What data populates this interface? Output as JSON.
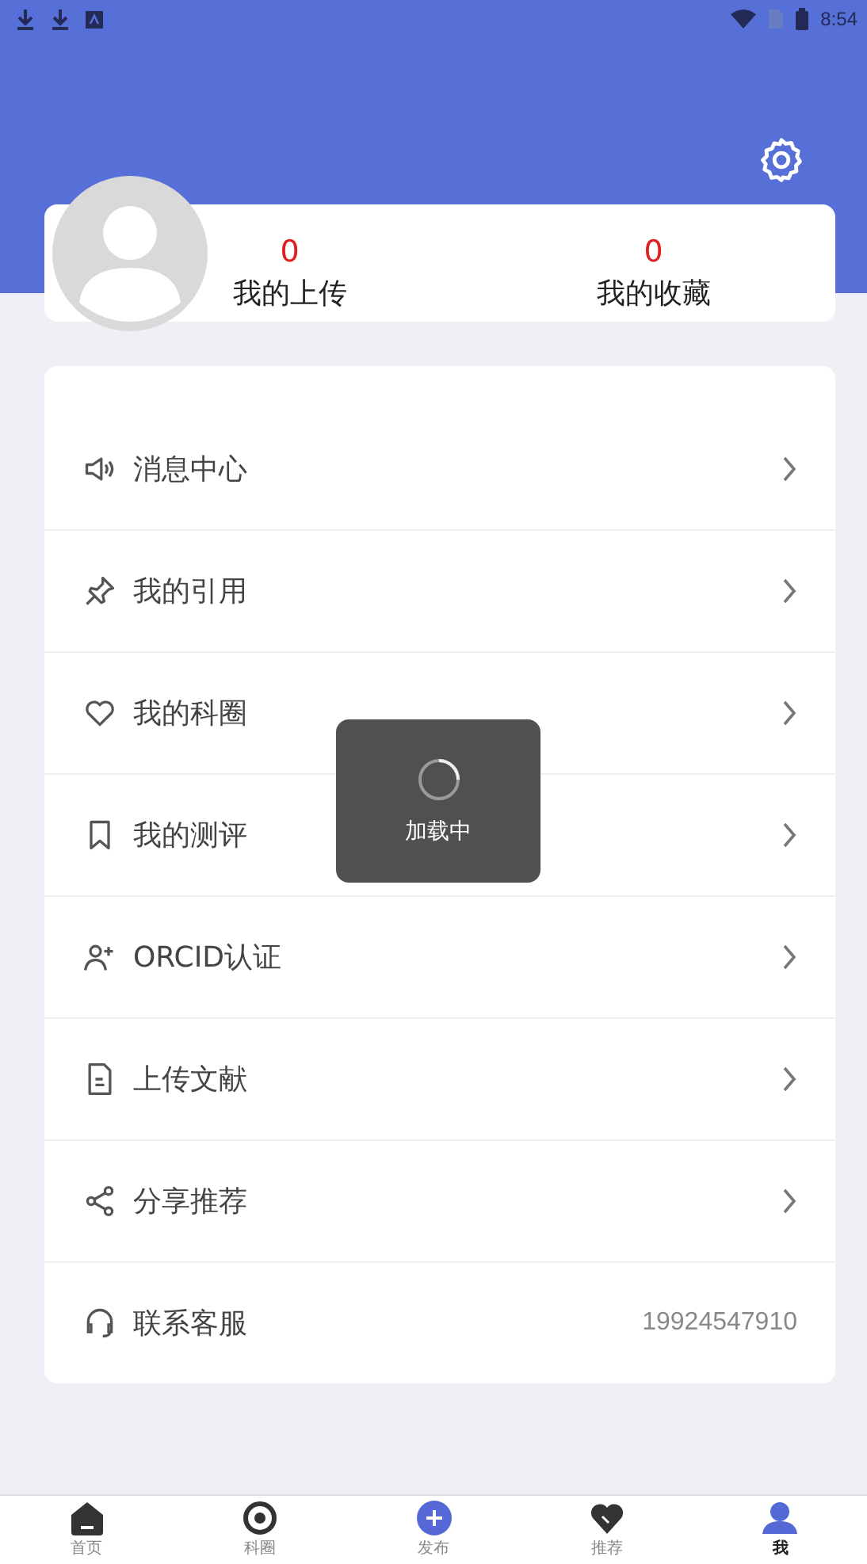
{
  "status_bar": {
    "time": "8:54"
  },
  "stats": [
    {
      "count": "0",
      "label": "我的上传"
    },
    {
      "count": "0",
      "label": "我的收藏"
    }
  ],
  "menu": [
    {
      "label": "消息中心"
    },
    {
      "label": "我的引用"
    },
    {
      "label": "我的科圈"
    },
    {
      "label": "我的测评"
    },
    {
      "label": "ORCID认证"
    },
    {
      "label": "上传文献"
    },
    {
      "label": "分享推荐"
    },
    {
      "label": "联系客服",
      "value": "19924547910"
    }
  ],
  "toast": {
    "text": "加载中"
  },
  "tabs": [
    {
      "label": "首页",
      "selected": false
    },
    {
      "label": "科圈",
      "selected": false
    },
    {
      "label": "发布",
      "selected": false
    },
    {
      "label": "推荐",
      "selected": false
    },
    {
      "label": "我",
      "selected": true
    }
  ]
}
